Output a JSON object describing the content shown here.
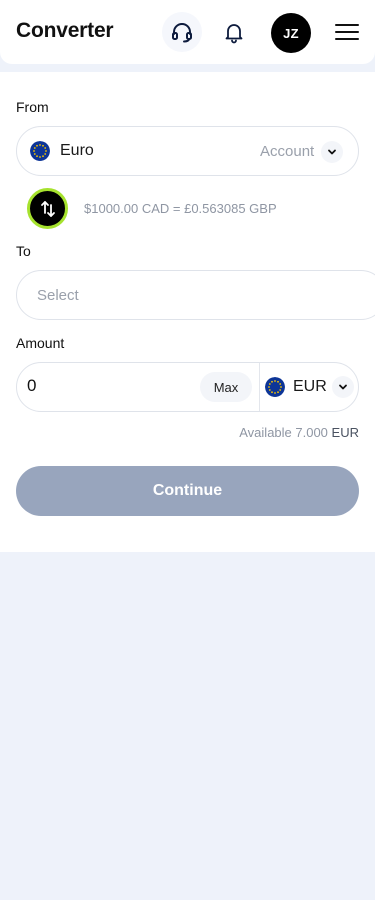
{
  "header": {
    "title": "Converter",
    "avatar_initials": "JZ",
    "icons": [
      "headset-icon",
      "bell-icon",
      "hamburger-menu-icon"
    ]
  },
  "form": {
    "from_label": "From",
    "from_currency": "Euro",
    "from_account_placeholder": "Account",
    "rate_text": "$1000.00 CAD = £0.563085 GBP",
    "to_label": "To",
    "to_placeholder": "Select",
    "amount_label": "Amount",
    "amount_value": "0",
    "max_label": "Max",
    "amount_currency": "EUR",
    "available_prefix": "Available 7.000",
    "available_currency": "EUR",
    "continue_label": "Continue"
  },
  "colors": {
    "accent_green": "#a6e22e",
    "button_disabled": "#98a5bd",
    "page_background": "#eef2fa",
    "eu_blue": "#0d3597",
    "eu_gold": "#f5c400"
  }
}
